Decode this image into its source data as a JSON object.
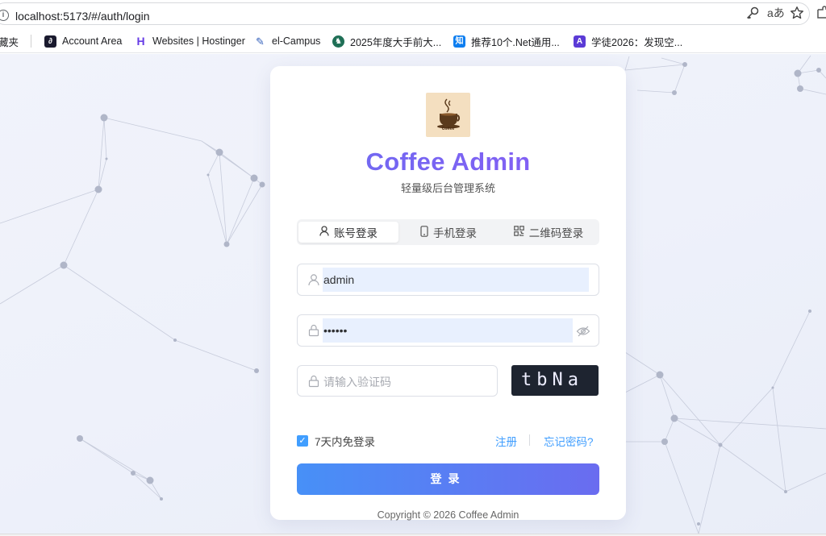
{
  "browser": {
    "url": "localhost:5173/#/auth/login",
    "bookmarks": [
      {
        "label": "藏夹",
        "icon": "folder-icon"
      },
      {
        "label": "Account Area",
        "icon": "hostinger-account-icon"
      },
      {
        "label": "Websites | Hostinger",
        "icon": "hostinger-icon"
      },
      {
        "label": "el-Campus",
        "icon": "el-campus-icon"
      },
      {
        "label": "2025年度大手前大...",
        "icon": "otemae-icon"
      },
      {
        "label": "推荐10个.Net通用...",
        "icon": "zhihu-icon"
      },
      {
        "label": "学徒2026：发现空...",
        "icon": "app-a-icon"
      }
    ]
  },
  "login": {
    "logo_caption": "Coffee",
    "title": "Coffee Admin",
    "subtitle": "轻量级后台管理系统",
    "tabs": [
      {
        "label": "账号登录",
        "icon": "user-icon",
        "active": true
      },
      {
        "label": "手机登录",
        "icon": "mobile-icon",
        "active": false
      },
      {
        "label": "二维码登录",
        "icon": "qrcode-icon",
        "active": false
      }
    ],
    "username_value": "admin",
    "password_value": "••••••",
    "captcha_placeholder": "请输入验证码",
    "captcha_text": "tbNa",
    "remember_label": "7天内免登录",
    "remember_checked": true,
    "register_label": "注册",
    "forgot_label": "忘记密码?",
    "submit_label": "登录",
    "copyright": "Copyright © 2026 Coffee Admin"
  },
  "colors": {
    "accent": "#409eff",
    "title_gradient_start": "#6a6cf0",
    "title_gradient_end": "#8a5cf5",
    "autofill": "#e8f0fe"
  }
}
